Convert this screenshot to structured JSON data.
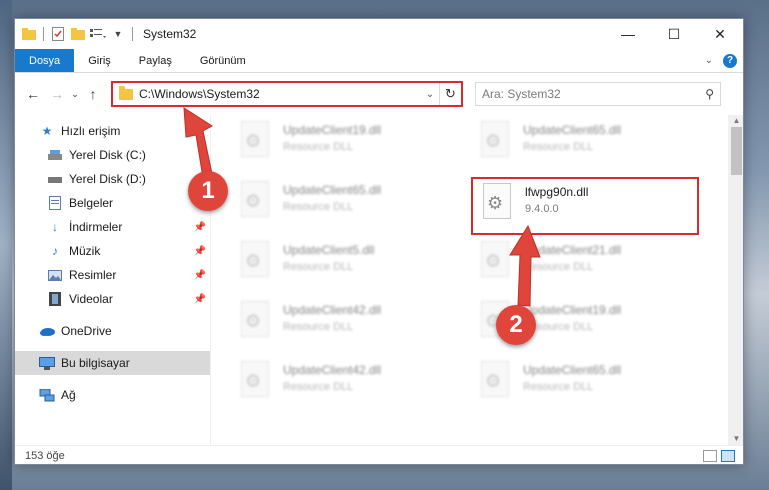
{
  "window": {
    "title": "System32"
  },
  "ribbon": {
    "tabs": [
      {
        "label": "Dosya",
        "active": true
      },
      {
        "label": "Giriş",
        "active": false
      },
      {
        "label": "Paylaş",
        "active": false
      },
      {
        "label": "Görünüm",
        "active": false
      }
    ],
    "help": "?"
  },
  "address": {
    "path": "C:\\Windows\\System32",
    "search_placeholder": "Ara: System32"
  },
  "nav": {
    "items": [
      {
        "label": "Hızlı erişim",
        "icon": "star-icon"
      },
      {
        "label": "Yerel Disk (C:)",
        "icon": "drive-icon"
      },
      {
        "label": "Yerel Disk (D:)",
        "icon": "drive-icon"
      },
      {
        "label": "Belgeler",
        "icon": "documents-icon"
      },
      {
        "label": "İndirmeler",
        "icon": "download-icon"
      },
      {
        "label": "Müzik",
        "icon": "music-icon"
      },
      {
        "label": "Resimler",
        "icon": "pictures-icon"
      },
      {
        "label": "Videolar",
        "icon": "videos-icon"
      },
      {
        "label": "OneDrive",
        "icon": "cloud-icon"
      },
      {
        "label": "Bu bilgisayar",
        "icon": "computer-icon"
      },
      {
        "label": "Ağ",
        "icon": "network-icon"
      }
    ]
  },
  "files": [
    {
      "name": "UpdateClient19.dll",
      "sub": "Resource DLL"
    },
    {
      "name": "UpdateClient65.dll",
      "sub": "Resource DLL"
    },
    {
      "name": "UpdateClient65.dll",
      "sub": "Resource DLL"
    },
    {
      "name": "lfwpg90n.dll",
      "sub": "9.4.0.0"
    },
    {
      "name": "UpdateClient5.dll",
      "sub": "Resource DLL"
    },
    {
      "name": "UpdateClient21.dll",
      "sub": "Resource DLL"
    },
    {
      "name": "UpdateClient42.dll",
      "sub": "Resource DLL"
    },
    {
      "name": "UpdateClient19.dll",
      "sub": "Resource DLL"
    },
    {
      "name": "UpdateClient42.dll",
      "sub": "Resource DLL"
    },
    {
      "name": "UpdateClient65.dll",
      "sub": "Resource DLL"
    }
  ],
  "status": {
    "count": "153 öğe"
  },
  "annotations": {
    "step1": "1",
    "step2": "2",
    "color": "#e0453b"
  }
}
